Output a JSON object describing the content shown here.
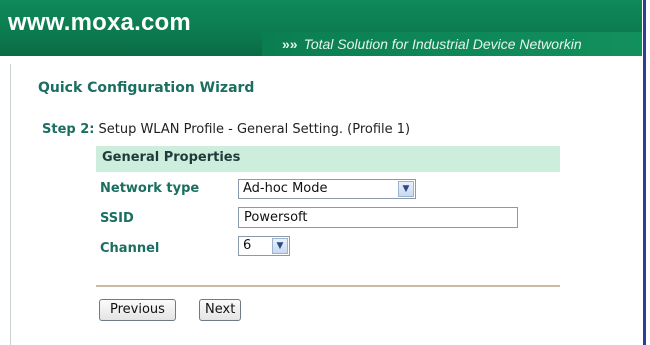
{
  "header": {
    "logo_text": "www.moxa.com",
    "tagline_chevron": "»»",
    "tagline": "Total Solution for Industrial Device Networkin"
  },
  "wizard": {
    "title": "Quick Configuration Wizard",
    "step_label": "Step 2:",
    "step_text": "Setup WLAN Profile - General Setting. (Profile 1)"
  },
  "general_properties": {
    "header": "General Properties",
    "network_type": {
      "label": "Network type",
      "value": "Ad-hoc Mode"
    },
    "ssid": {
      "label": "SSID",
      "value": "Powersoft"
    },
    "channel": {
      "label": "Channel",
      "value": "6"
    }
  },
  "buttons": {
    "previous": "Previous",
    "next": "Next"
  },
  "colors": {
    "banner": "#0c7a4f",
    "label": "#1b6e61",
    "section_header_bg": "#cdeedd"
  }
}
